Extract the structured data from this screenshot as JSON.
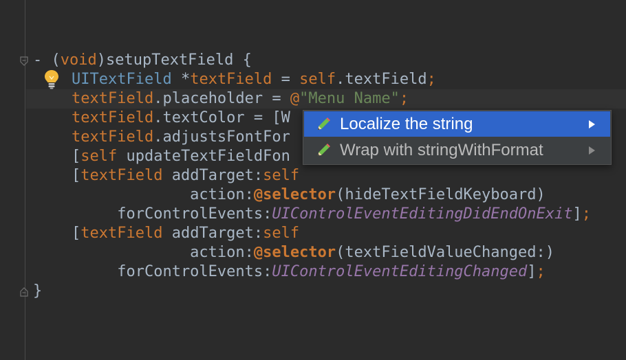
{
  "editor": {
    "lines": [
      [
        [
          "- (",
          "tok-plain"
        ],
        [
          "void",
          "tok-key"
        ],
        [
          ")setupTextField {",
          "tok-plain"
        ]
      ],
      [
        [
          "UITextField",
          "tok-type"
        ],
        [
          " *",
          "tok-plain"
        ],
        [
          "textField",
          "tok-key"
        ],
        [
          " = ",
          "tok-plain"
        ],
        [
          "self",
          "tok-key"
        ],
        [
          ".textField",
          "tok-plain"
        ],
        [
          ";",
          "tok-semi"
        ]
      ],
      [
        [
          "textField",
          "tok-key"
        ],
        [
          ".placeholder = ",
          "tok-plain"
        ],
        [
          "@",
          "tok-at"
        ],
        [
          "\"Menu Name\"",
          "tok-str"
        ],
        [
          ";",
          "tok-semi"
        ]
      ],
      [
        [
          "textField",
          "tok-key"
        ],
        [
          ".textColor = [W",
          "tok-plain"
        ]
      ],
      [
        [
          "textField",
          "tok-key"
        ],
        [
          ".adjustsFontFor",
          "tok-plain"
        ]
      ],
      [
        [
          "[",
          "tok-brack"
        ],
        [
          "self",
          "tok-key"
        ],
        [
          " updateTextFieldFon",
          "tok-plain"
        ]
      ],
      [
        [
          "[",
          "tok-brack"
        ],
        [
          "textField",
          "tok-key"
        ],
        [
          " addTarget:",
          "tok-plain"
        ],
        [
          "self",
          "tok-key"
        ]
      ],
      [
        [
          "             action:",
          "tok-plain"
        ],
        [
          "@selector",
          "tok-sel"
        ],
        [
          "(hideTextFieldKeyboard)",
          "tok-plain"
        ]
      ],
      [
        [
          "     forControlEvents:",
          "tok-plain"
        ],
        [
          "UIControlEventEditingDidEndOnExit",
          "tok-enum"
        ],
        [
          "]",
          "tok-brack"
        ],
        [
          ";",
          "tok-semi"
        ]
      ],
      [
        [
          "[",
          "tok-brack"
        ],
        [
          "textField",
          "tok-key"
        ],
        [
          " addTarget:",
          "tok-plain"
        ],
        [
          "self",
          "tok-key"
        ]
      ],
      [
        [
          "             action:",
          "tok-plain"
        ],
        [
          "@selector",
          "tok-sel"
        ],
        [
          "(textFieldValueChanged:)",
          "tok-plain"
        ]
      ],
      [
        [
          "     forControlEvents:",
          "tok-plain"
        ],
        [
          "UIControlEventEditingChanged",
          "tok-enum"
        ],
        [
          "]",
          "tok-brack"
        ],
        [
          ";",
          "tok-semi"
        ]
      ],
      [
        [
          "}",
          "tok-plain"
        ]
      ]
    ],
    "current_line_index": 2
  },
  "popup": {
    "items": [
      {
        "label": "Localize the string",
        "icon": "pencil-icon",
        "selected": true
      },
      {
        "label": "Wrap with stringWithFormat",
        "icon": "pencil-icon",
        "selected": false
      }
    ]
  },
  "icons": {
    "intention": "lightbulb-icon",
    "fold_start": "fold-marker-icon",
    "fold_end": "fold-marker-icon",
    "submenu": "chevron-right-icon"
  },
  "colors": {
    "background": "#2b2b2b",
    "current_line": "#323232",
    "keyword": "#cc7832",
    "string": "#6a8759",
    "type": "#6897bb",
    "enum_constant": "#9876aa",
    "popup_selected": "#2f65ca"
  }
}
